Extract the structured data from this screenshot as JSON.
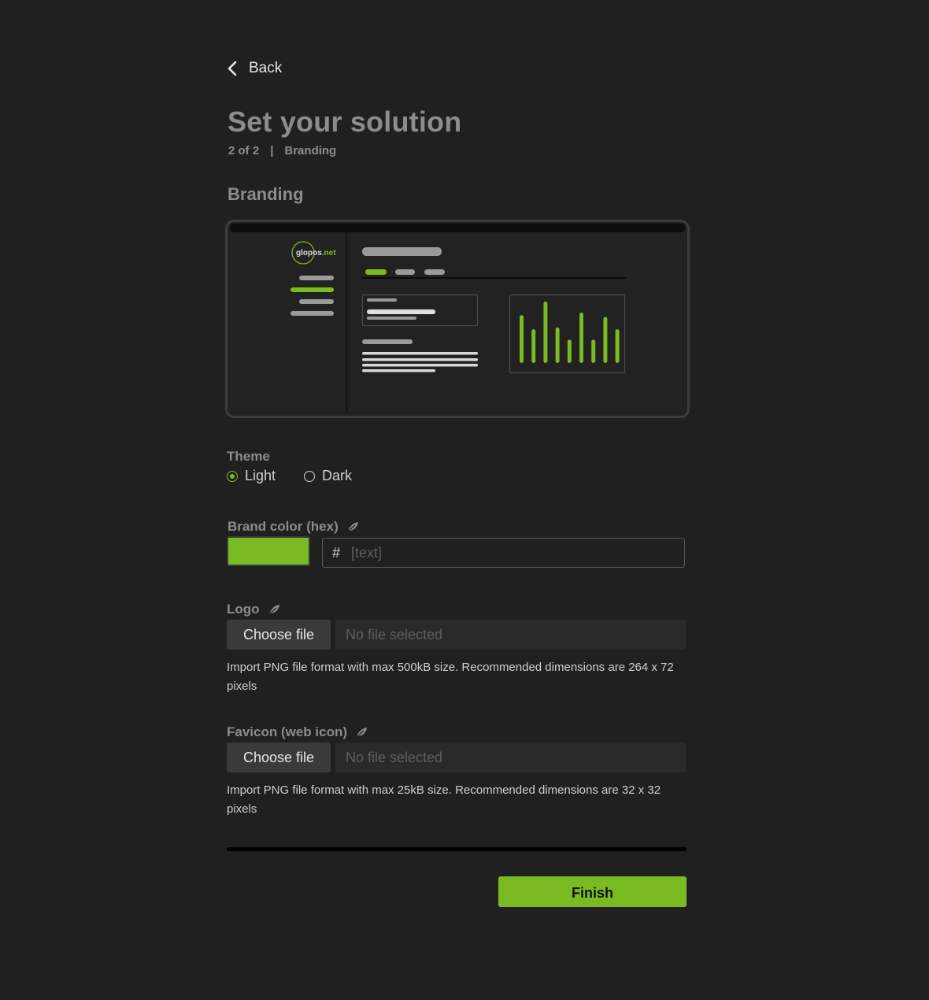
{
  "nav": {
    "back_label": "Back"
  },
  "header": {
    "title": "Set your solution",
    "step": "2 of 2",
    "separator": "|",
    "step_name": "Branding"
  },
  "section": {
    "title": "Branding"
  },
  "preview": {
    "logo_text_main": "glopos",
    "logo_text_accent": ".net",
    "accent_color": "#7abb23",
    "chart_bars": [
      0.78,
      0.55,
      1.0,
      0.58,
      0.38,
      0.82,
      0.38,
      0.75,
      0.55
    ]
  },
  "theme": {
    "label": "Theme",
    "options": [
      {
        "label": "Light",
        "selected": true
      },
      {
        "label": "Dark",
        "selected": false
      }
    ]
  },
  "brand_color": {
    "label": "Brand color (hex)",
    "hash": "#",
    "placeholder": "[text]",
    "swatch_color": "#7abb23"
  },
  "logo": {
    "label": "Logo",
    "button_label": "Choose file",
    "file_name": "No file selected",
    "help": "Import PNG file format with max 500kB size. Recommended dimensions are 264 x 72 pixels"
  },
  "favicon": {
    "label": "Favicon (web icon)",
    "button_label": "Choose file",
    "file_name": "No file selected",
    "help": "Import PNG file format with max 25kB size. Recommended dimensions are 32 x 32 pixels"
  },
  "footer": {
    "finish_label": "Finish"
  },
  "icons": {
    "back": "chevron-left-icon",
    "leaf": "leaf-icon"
  }
}
